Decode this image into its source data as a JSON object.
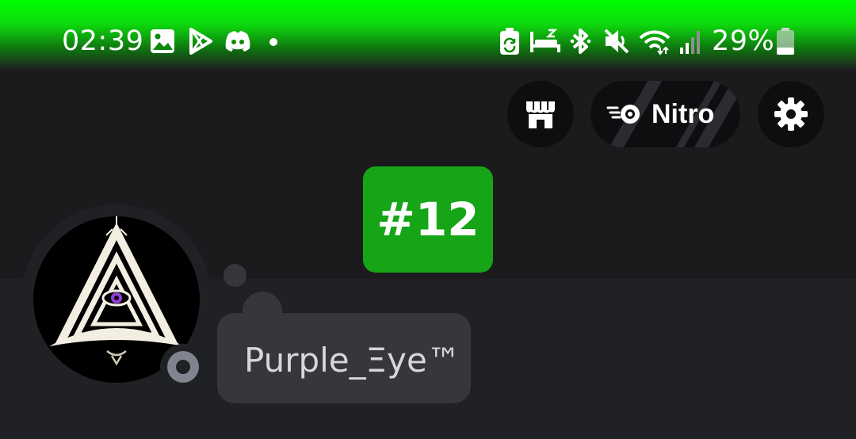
{
  "status_bar": {
    "time": "02:39",
    "battery_percent": "29%",
    "battery_level": 0.29,
    "left_icons": [
      "gallery-icon",
      "play-store-icon",
      "discord-icon",
      "notification-dot-icon"
    ],
    "right_icons": [
      "battery-saver-icon",
      "sleep-mode-icon",
      "bluetooth-icon",
      "mute-icon",
      "wifi-icon",
      "signal-icon",
      "battery-icon"
    ]
  },
  "header": {
    "shop_icon": "shop-icon",
    "nitro_label": "Nitro",
    "settings_icon": "gear-icon"
  },
  "rank_badge": "#12",
  "profile": {
    "status_text": "Purple_Ξye™",
    "online_status": "offline"
  },
  "colors": {
    "status_bar_green": "#00ff00",
    "badge_green": "#16a516",
    "background": "#1b1b1d",
    "bubble": "#36373d"
  }
}
